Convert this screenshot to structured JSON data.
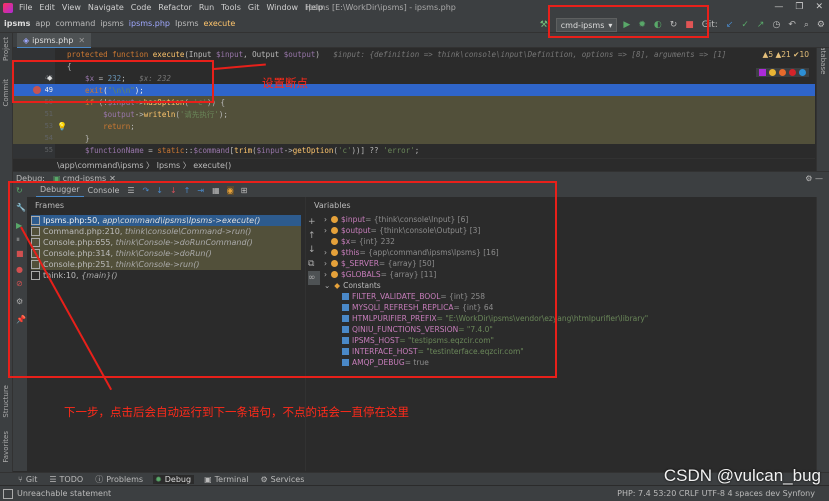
{
  "titlebar": {
    "menu": [
      "File",
      "Edit",
      "View",
      "Navigate",
      "Code",
      "Refactor",
      "Run",
      "Tools",
      "Git",
      "Window",
      "Help"
    ],
    "title": "ipsms [E:\\WorkDir\\ipsms] - ipsms.php"
  },
  "navbar": {
    "crumbs": [
      "ipsms",
      "app",
      "command",
      "ipsms",
      "ipsms.php",
      "Ipsms",
      "execute"
    ],
    "run_config": "cmd-ipsms",
    "git_label": "Git:"
  },
  "editor": {
    "tab": "ipsms.php",
    "inspections": "▲5 ▲21 ✔10",
    "lines": [
      {
        "n": "",
        "t": "protected function execute(Input $input, Output $output)   $input: {definition => think\\console\\input\\Definition, options => [8], arguments => [1]"
      },
      {
        "n": "",
        "t": "{"
      },
      {
        "n": "48",
        "t": "    $x = 232;   $x: 232"
      },
      {
        "n": "49",
        "t": "    exit(\"\\n\\n\");"
      },
      {
        "n": "50",
        "t": "    if (!$input->hasOption( 'c')) {"
      },
      {
        "n": "51",
        "t": "        $output->writeln('请先执行');"
      },
      {
        "n": "53",
        "t": "        return;"
      },
      {
        "n": "54",
        "t": "    }"
      },
      {
        "n": "55",
        "t": "    $functionName = static::$command[trim($input->getOption('c'))] ?? 'error';"
      }
    ],
    "breadcrumb": "\\app\\command\\ipsms   〉  Ipsms   〉  execute()"
  },
  "debug": {
    "label": "Debug:",
    "config_tab": "cmd-ipsms",
    "tabs": [
      "Debugger",
      "Console"
    ],
    "frames_header": "Frames",
    "frames": [
      {
        "loc": "Ipsms.php:50,",
        "ctx": "app\\command\\ipsms\\Ipsms->execute()"
      },
      {
        "loc": "Command.php:210,",
        "ctx": "think\\console\\Command->run()"
      },
      {
        "loc": "Console.php:655,",
        "ctx": "think\\Console->doRunCommand()"
      },
      {
        "loc": "Console.php:314,",
        "ctx": "think\\Console->doRun()"
      },
      {
        "loc": "Console.php:251,",
        "ctx": "think\\Console->run()"
      },
      {
        "loc": "think:10,",
        "ctx": "{main}()"
      }
    ],
    "variables_header": "Variables",
    "variables": [
      {
        "name": "$input",
        "val": " = {think\\console\\Input} [6]"
      },
      {
        "name": "$output",
        "val": " = {think\\console\\Output} [3]"
      },
      {
        "name": "$x",
        "val": " = {int} 232"
      },
      {
        "name": "$this",
        "val": " = {app\\command\\ipsms\\Ipsms} [16]"
      },
      {
        "name": "$_SERVER",
        "val": " = {array} [50]"
      },
      {
        "name": "$GLOBALS",
        "val": " = {array} [11]"
      }
    ],
    "constants_label": "Constants",
    "constants": [
      {
        "name": "FILTER_VALIDATE_BOOL",
        "val": " = {int} 258"
      },
      {
        "name": "MYSQLI_REFRESH_REPLICA",
        "val": " = {int} 64"
      },
      {
        "name": "HTMLPURIFIER_PREFIX",
        "val": " = \"E:\\WorkDir\\ipsms\\vendor\\ezyang\\htmlpurifier\\library\""
      },
      {
        "name": "QINIU_FUNCTIONS_VERSION",
        "val": " = \"7.4.0\""
      },
      {
        "name": "IPSMS_HOST",
        "val": " = \"testipsms.eqzcir.com\""
      },
      {
        "name": "INTERFACE_HOST",
        "val": " = \"testinterface.eqzcir.com\""
      },
      {
        "name": "AMQP_DEBUG",
        "val": " = true"
      }
    ]
  },
  "side_labels": {
    "project": "Project",
    "commit": "Commit",
    "structure": "Structure",
    "favorites": "Favorites",
    "database": "Database"
  },
  "bottom_tabs": [
    "Git",
    "TODO",
    "Problems",
    "Debug",
    "Terminal",
    "Services"
  ],
  "status": {
    "message": "Unreachable statement",
    "right": "PHP: 7.4   53:20   CRLF   UTF-8   4 spaces   dev   Synfony"
  },
  "annotations": {
    "breakpoint_note": "设置断点",
    "step_note": "下一步，点击后会自动运行到下一条语句，不点的话会一直停在这里"
  },
  "watermark": "CSDN @vulcan_bug",
  "colors": {
    "annotation": "#e8201a",
    "selection": "#2d5b8e",
    "exec_line": "#2f65ca"
  }
}
